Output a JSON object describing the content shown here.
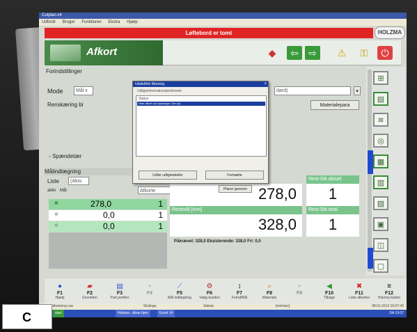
{
  "window": {
    "title": "Cutplan.v4",
    "menu": [
      "Udfordr",
      "Bruger",
      "Funktioner",
      "Ekstra",
      "Hjælp"
    ]
  },
  "alert_bar": "Løftebord er tomt",
  "logo": "HOLZMA",
  "header": {
    "title": "Afkort"
  },
  "settings": {
    "section_label": "Forindstillinger",
    "mode_label": "Mode",
    "mode_value": "Mål x",
    "trim_label": "Renskæring bi",
    "clamp_label": "Spændetær",
    "material_button": "Materialepara",
    "partial_field": "dard)"
  },
  "dialog": {
    "title": "Udskriftsh Warning",
    "subtitle": "Udligeinformationsbeskrivele",
    "list_row1": "Status",
    "list_row2": "Hele afkort ud-reparasjon. Den Ap.",
    "btn_left": "Udfør udligetabeller",
    "btn_right": "Fortsætte",
    "btn_bottom": "Planer gennem"
  },
  "list": {
    "section_label": "Målindlægning",
    "list_label": "Liste",
    "list_value": "(Aktu",
    "sub_field": "Afkorte",
    "col_active": "aktiv",
    "col_measure": "Mål",
    "rows": [
      {
        "value": "278,0",
        "count": "1"
      },
      {
        "value": "0,0",
        "count": "1"
      },
      {
        "value": "0,0",
        "count": "1"
      }
    ]
  },
  "results": {
    "current_value": "278,0",
    "rest_label_actual": "Rest-Stk aktuel",
    "rest_actual": "1",
    "remaining_label": "Restmål [mm]",
    "remaining_value": "328,0",
    "rest_label_total": "Rest-Stk total",
    "rest_total": "1",
    "summary": "Påkrævet: 328,0   Eksisterende: 328,0   Fri: 0,0"
  },
  "fkeys": [
    {
      "key": "F1",
      "sub": "Hjælp",
      "icon": "help-icon"
    },
    {
      "key": "F2",
      "sub": "Ensretten",
      "icon": "stack-icon"
    },
    {
      "key": "F3",
      "sub": "Part profilen",
      "icon": "layers-icon"
    },
    {
      "key": "F4",
      "sub": "",
      "icon": "blank-icon"
    },
    {
      "key": "F5",
      "sub": "Mål indlægning",
      "icon": "ruler-icon"
    },
    {
      "key": "F6",
      "sub": "Vælg kunden",
      "icon": "gear-icon"
    },
    {
      "key": "F7",
      "sub": "Fornd/Mål",
      "icon": "arrows-icon"
    },
    {
      "key": "F8",
      "sub": "Materiale",
      "icon": "search-icon"
    },
    {
      "key": "F9",
      "sub": "",
      "icon": "blank-icon"
    },
    {
      "key": "F10",
      "sub": "Tilbage",
      "icon": "back-icon"
    },
    {
      "key": "F11",
      "sub": "Liste afkortes",
      "icon": "stop-icon"
    },
    {
      "key": "F12",
      "sub": "Holzma kiarter",
      "icon": "list-icon"
    }
  ],
  "status": {
    "left": "Indge afkortning nav",
    "mid1": "Skrånge",
    "mid2": "Sidista",
    "right": "[mm/sec]",
    "time": "08.01.2013 10:07:42"
  },
  "taskbar": {
    "start": "start",
    "task1": "Holzma - dtrue hjerr",
    "task2": "Excel 14",
    "clock": "DA 10:07"
  },
  "corner_label": "C",
  "colors": {
    "alert": "#e02424",
    "accent_green": "#7ac48c",
    "header_green": "#3f7a3f",
    "blue": "#1f4ad0"
  }
}
